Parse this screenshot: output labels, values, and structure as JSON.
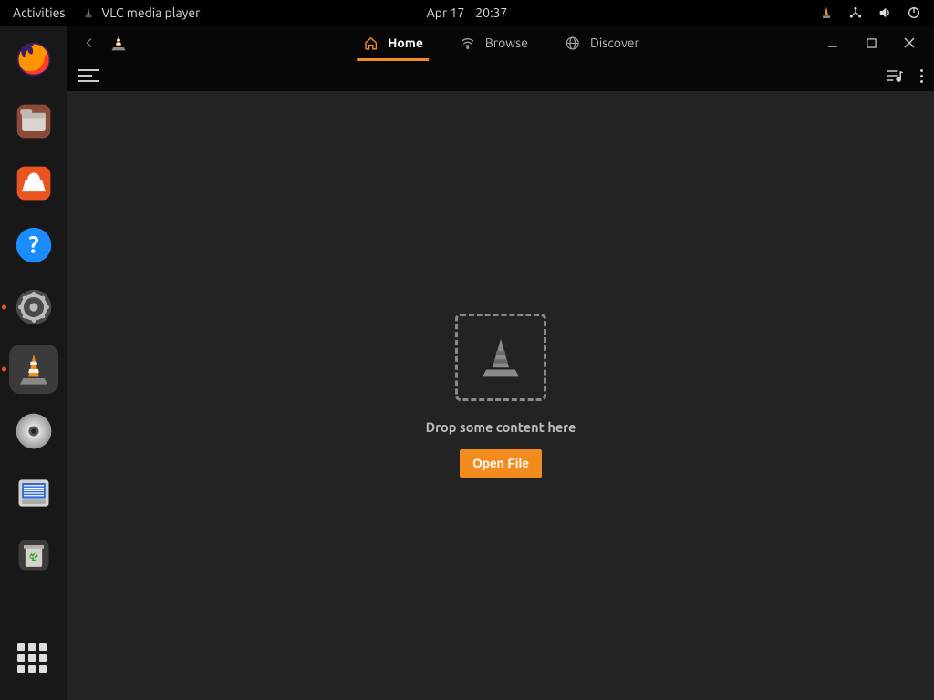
{
  "topbar": {
    "activities": "Activities",
    "app_name": "VLC media player",
    "date": "Apr 17",
    "time": "20:37"
  },
  "dock": {
    "items": [
      {
        "name": "firefox"
      },
      {
        "name": "files"
      },
      {
        "name": "software"
      },
      {
        "name": "help"
      },
      {
        "name": "settings",
        "running": true
      },
      {
        "name": "vlc",
        "active": true,
        "running": true
      },
      {
        "name": "disc"
      },
      {
        "name": "scanner"
      },
      {
        "name": "trash"
      }
    ]
  },
  "window": {
    "tabs": {
      "home": "Home",
      "browse": "Browse",
      "discover": "Discover"
    },
    "drop_text": "Drop some content here",
    "open_file": "Open File"
  }
}
